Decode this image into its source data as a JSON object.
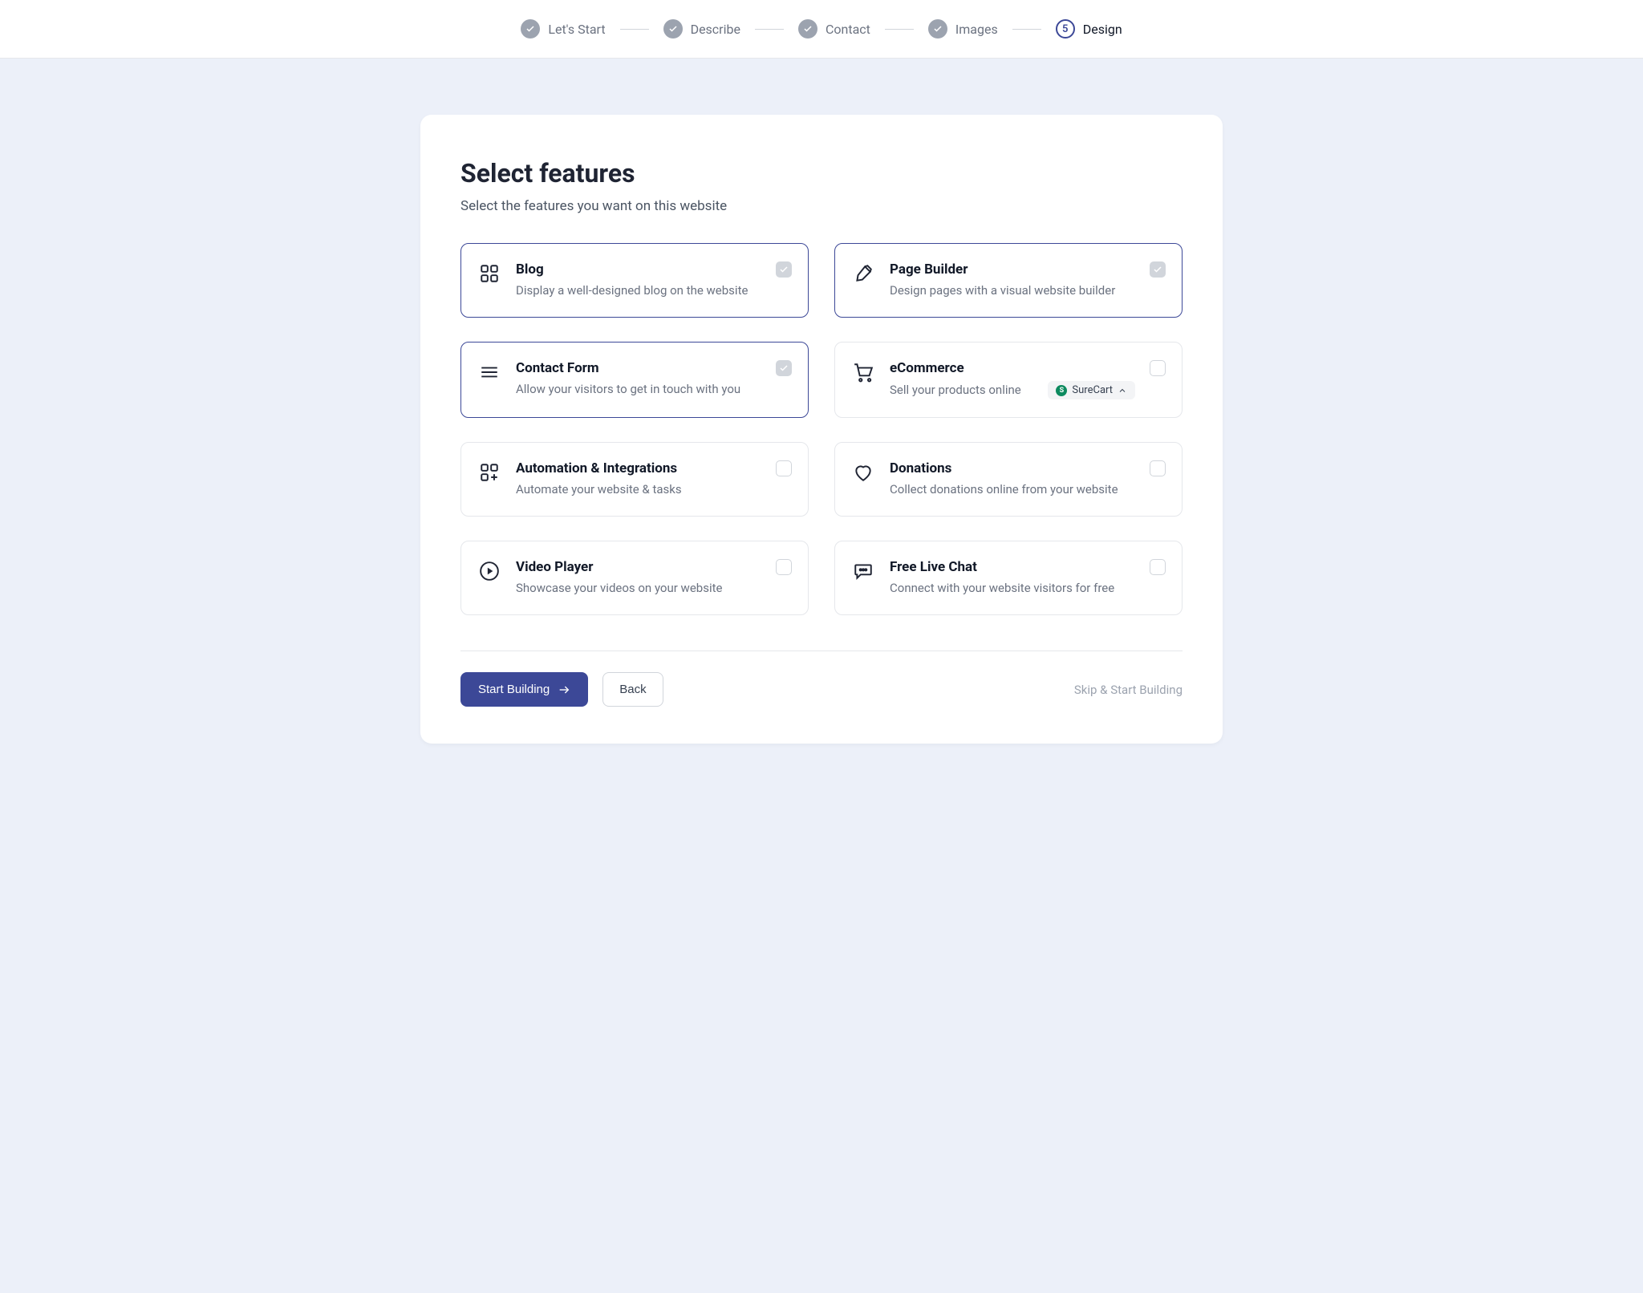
{
  "stepper": {
    "steps": [
      {
        "label": "Let's Start",
        "done": true
      },
      {
        "label": "Describe",
        "done": true
      },
      {
        "label": "Contact",
        "done": true
      },
      {
        "label": "Images",
        "done": true
      },
      {
        "label": "Design",
        "done": false,
        "number": "5",
        "active": true
      }
    ]
  },
  "page": {
    "title": "Select features",
    "subtitle": "Select the features you want on this website"
  },
  "features": [
    {
      "id": "blog",
      "title": "Blog",
      "desc": "Display a well-designed blog on the website",
      "selected": true,
      "icon": "grid"
    },
    {
      "id": "page-builder",
      "title": "Page Builder",
      "desc": "Design pages with a visual website builder",
      "selected": true,
      "icon": "brush"
    },
    {
      "id": "contact-form",
      "title": "Contact Form",
      "desc": "Allow your visitors to get in touch with you",
      "selected": true,
      "icon": "lines"
    },
    {
      "id": "ecommerce",
      "title": "eCommerce",
      "desc": "Sell your products online",
      "selected": false,
      "icon": "cart",
      "badge": "SureCart"
    },
    {
      "id": "automation",
      "title": "Automation & Integrations",
      "desc": "Automate your website & tasks",
      "selected": false,
      "icon": "grid-plus"
    },
    {
      "id": "donations",
      "title": "Donations",
      "desc": "Collect donations online from your website",
      "selected": false,
      "icon": "heart"
    },
    {
      "id": "video-player",
      "title": "Video Player",
      "desc": "Showcase your videos on your website",
      "selected": false,
      "icon": "play"
    },
    {
      "id": "live-chat",
      "title": "Free Live Chat",
      "desc": "Connect with your website visitors for free",
      "selected": false,
      "icon": "chat"
    }
  ],
  "footer": {
    "primary": "Start Building",
    "secondary": "Back",
    "skip": "Skip & Start Building"
  }
}
